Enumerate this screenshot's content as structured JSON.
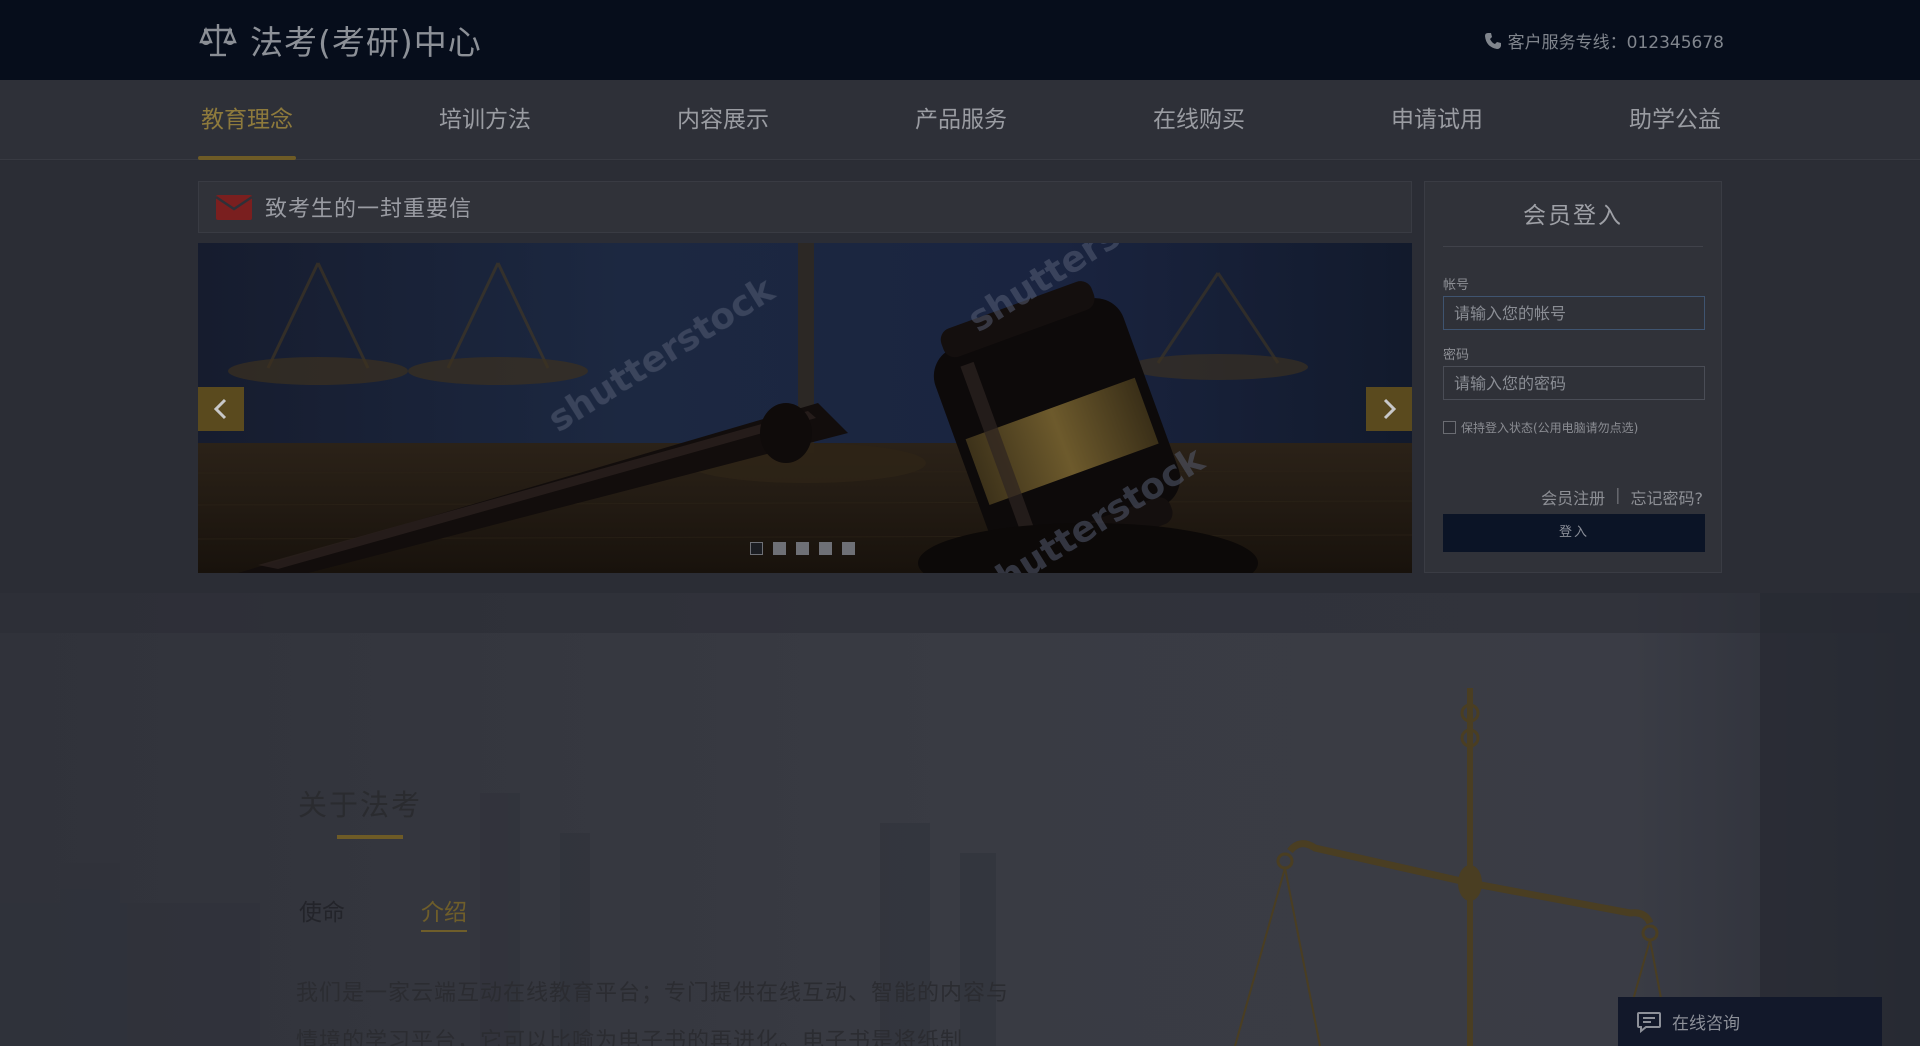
{
  "header": {
    "site_title": "法考(考研)中心",
    "hotline": "客户服务专线：012345678"
  },
  "nav": {
    "items": [
      {
        "label": "教育理念",
        "active": true
      },
      {
        "label": "培训方法"
      },
      {
        "label": "内容展示"
      },
      {
        "label": "产品服务"
      },
      {
        "label": "在线购买"
      },
      {
        "label": "申请试用"
      },
      {
        "label": "助学公益"
      }
    ]
  },
  "letter": {
    "title": "致考生的一封重要信"
  },
  "slider": {
    "watermark": "shutterstock",
    "slide_count": 5,
    "active_slide": 1
  },
  "login": {
    "title": "会员登入",
    "account_label": "帐号",
    "account_placeholder": "请输入您的帐号",
    "password_label": "密码",
    "password_placeholder": "请输入您的密码",
    "remember_label": "保持登入状态(公用电脑请勿点选)",
    "register_link": "会员注册",
    "separator": "|",
    "forgot_link": "忘记密码?",
    "submit_label": "登入"
  },
  "about": {
    "title": "关于法考",
    "tabs": [
      {
        "label": "使命"
      },
      {
        "label": "介绍",
        "active": true
      }
    ],
    "text": "我们是一家云端互动在线教育平台；专门提供在线互动、智能的内容与情境的学习平台，它可以比喻为电子书的再进化。电子书是将纸制"
  },
  "chat": {
    "label": "在线咨询"
  },
  "colors": {
    "accent_gold": "#6e5b26",
    "top_bar": "#060d1b",
    "login_button": "#0b1426"
  }
}
